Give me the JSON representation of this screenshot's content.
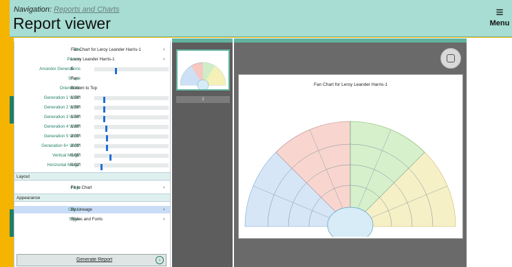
{
  "header": {
    "nav_prefix": "Navigation:",
    "nav_link": "Reports and Charts",
    "title": "Report viewer",
    "menu_label": "Menu"
  },
  "settings": {
    "title": {
      "label": "Title",
      "value": "Fan Chart for Leroy Leander Harris-1"
    },
    "person": {
      "label": "Person",
      "value": "Leroy Leander Harris-1"
    },
    "ancestor_generations": {
      "label": "Ancestor Generations",
      "value": "5",
      "level": 0.28
    },
    "shape": {
      "label": "Shape",
      "value": "Fan"
    },
    "orientation": {
      "label": "Orientation",
      "value": "Bottom to Top"
    },
    "gen1": {
      "label": "Generation 1 Width",
      "value": "1.50\"",
      "level": 0.12
    },
    "gen2": {
      "label": "Generation 2 Width",
      "value": "1.50\"",
      "level": 0.12
    },
    "gen3": {
      "label": "Generation 3 Width",
      "value": "1.50\"",
      "level": 0.12
    },
    "gen4": {
      "label": "Generation 4 Width",
      "value": "1.80\"",
      "level": 0.15
    },
    "gen5": {
      "label": "Generation 5 Width",
      "value": "2.00\"",
      "level": 0.16
    },
    "gen6": {
      "label": "Generation 6+ Width",
      "value": "2.00\"",
      "level": 0.16
    },
    "vmargin": {
      "label": "Vertical Margin",
      "value": "0.05\"",
      "level": 0.2
    },
    "hmargin": {
      "label": "Horizontal Margin",
      "value": "0.02\"",
      "level": 0.08
    }
  },
  "layout": {
    "section": "Layout",
    "page_label": "Page",
    "page_value": "Fit to Chart"
  },
  "appearance": {
    "section": "Appearance",
    "colors_label": "Colors",
    "colors_value": "By Lineage",
    "styles_label": "Styles",
    "styles_value": "Styles and Fonts"
  },
  "generate_button": "Generate Report",
  "thumbnail": {
    "page_number": "1"
  },
  "document": {
    "title": "Fan Chart for Leroy Leander Harris-1"
  },
  "colors": {
    "header": "#a7ddd2",
    "frame": "#f4b400",
    "accent": "#1f7e65",
    "slider": "#1d6dd6"
  },
  "icons": [
    "menu-icon",
    "chevron-right-icon",
    "go-arrow-icon",
    "ocr-scan-icon"
  ]
}
